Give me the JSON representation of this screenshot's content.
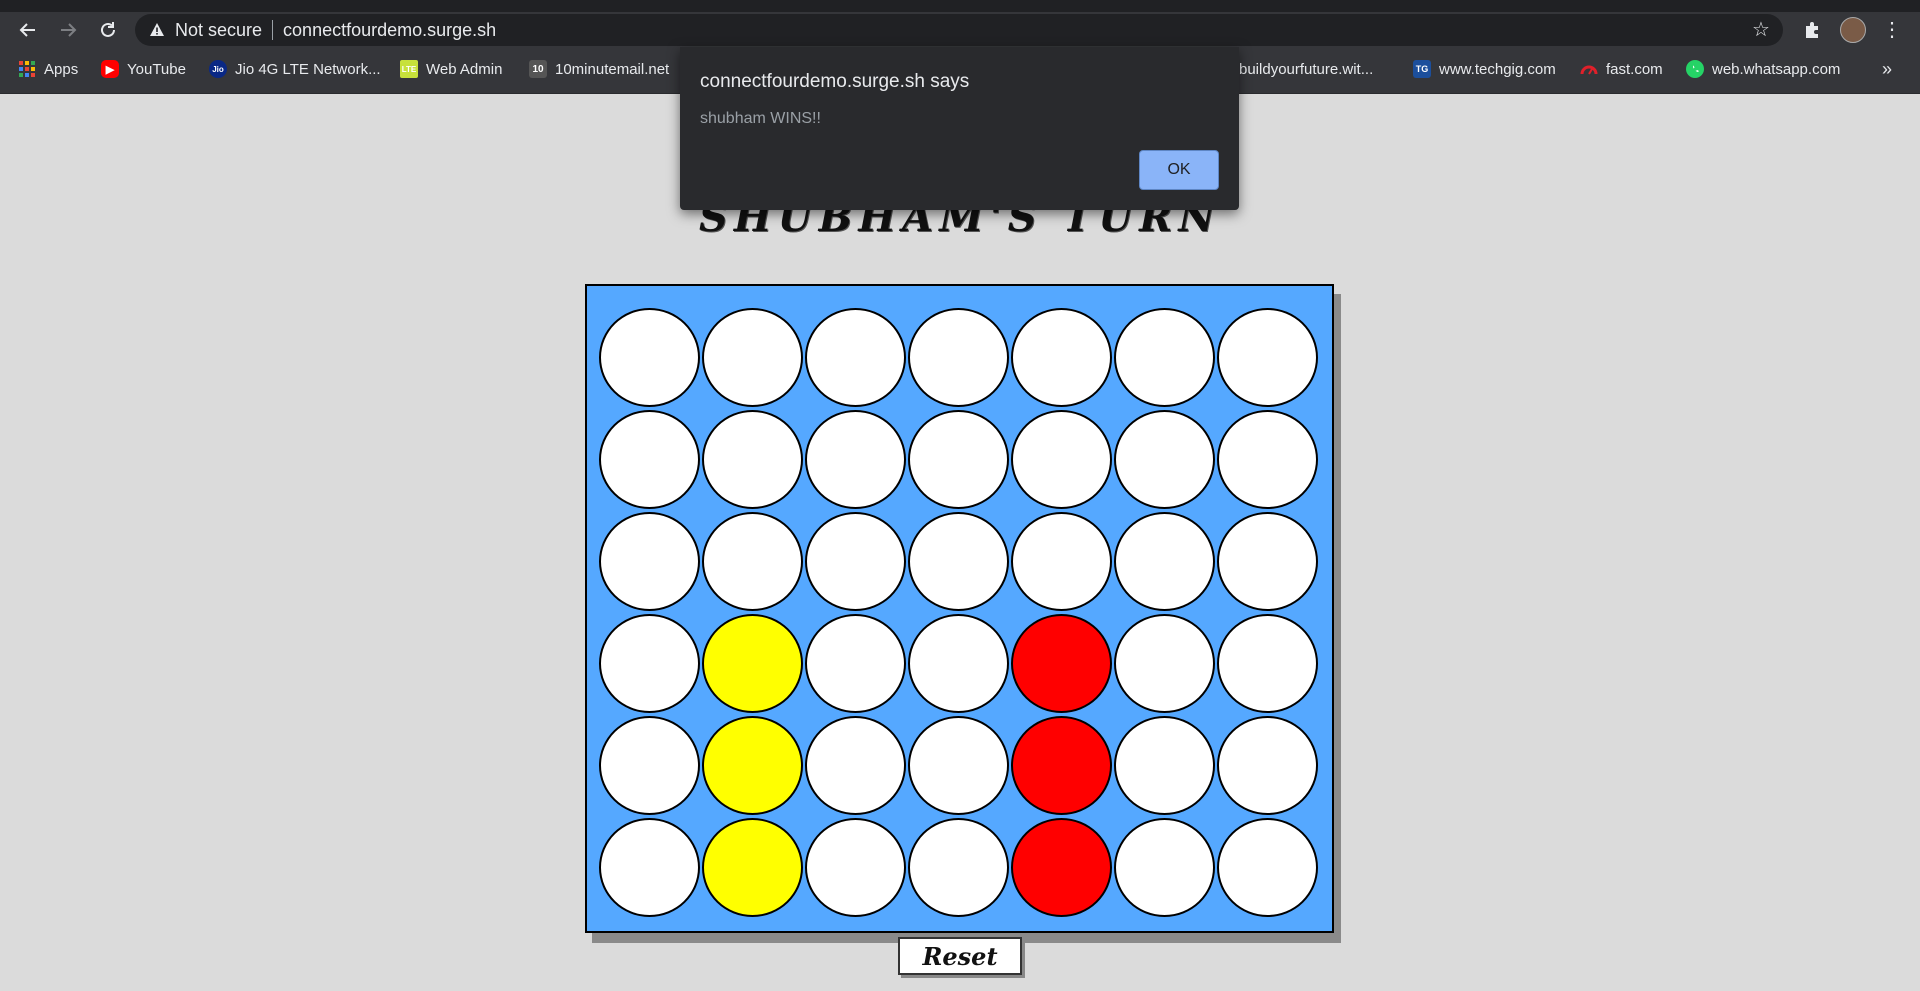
{
  "browser": {
    "security_label": "Not secure",
    "url": "connectfourdemo.surge.sh",
    "bookmarks": [
      {
        "label": "Apps",
        "icon": "apps-grid-icon"
      },
      {
        "label": "YouTube",
        "icon": "youtube-icon"
      },
      {
        "label": "Jio 4G LTE Network...",
        "icon": "jio-icon"
      },
      {
        "label": "Web Admin",
        "icon": "lte-icon"
      },
      {
        "label": "10minutemail.net",
        "icon": "10minutemail-icon"
      },
      {
        "label": "buildyourfuture.wit...",
        "icon": "buildyourfuture-icon"
      },
      {
        "label": "www.techgig.com",
        "icon": "techgig-icon"
      },
      {
        "label": "fast.com",
        "icon": "fast-icon"
      },
      {
        "label": "web.whatsapp.com",
        "icon": "whatsapp-icon"
      }
    ],
    "bookmarks_more": "»"
  },
  "dialog": {
    "title": "connectfourdemo.surge.sh says",
    "message": "shubham WINS!!",
    "ok_label": "OK"
  },
  "game": {
    "turn_text": "SHUBHAM'S TURN",
    "reset_label": "Reset",
    "colors": {
      "board": "#55a8ff",
      "empty": "#ffffff",
      "yellow": "#ffff00",
      "red": "#ff0000"
    },
    "grid": [
      [
        "empty",
        "empty",
        "empty",
        "empty",
        "empty",
        "empty",
        "empty"
      ],
      [
        "empty",
        "empty",
        "empty",
        "empty",
        "empty",
        "empty",
        "empty"
      ],
      [
        "empty",
        "empty",
        "empty",
        "empty",
        "empty",
        "empty",
        "empty"
      ],
      [
        "empty",
        "yellow",
        "empty",
        "empty",
        "red",
        "empty",
        "empty"
      ],
      [
        "empty",
        "yellow",
        "empty",
        "empty",
        "red",
        "empty",
        "empty"
      ],
      [
        "empty",
        "yellow",
        "empty",
        "empty",
        "red",
        "empty",
        "empty"
      ]
    ]
  }
}
